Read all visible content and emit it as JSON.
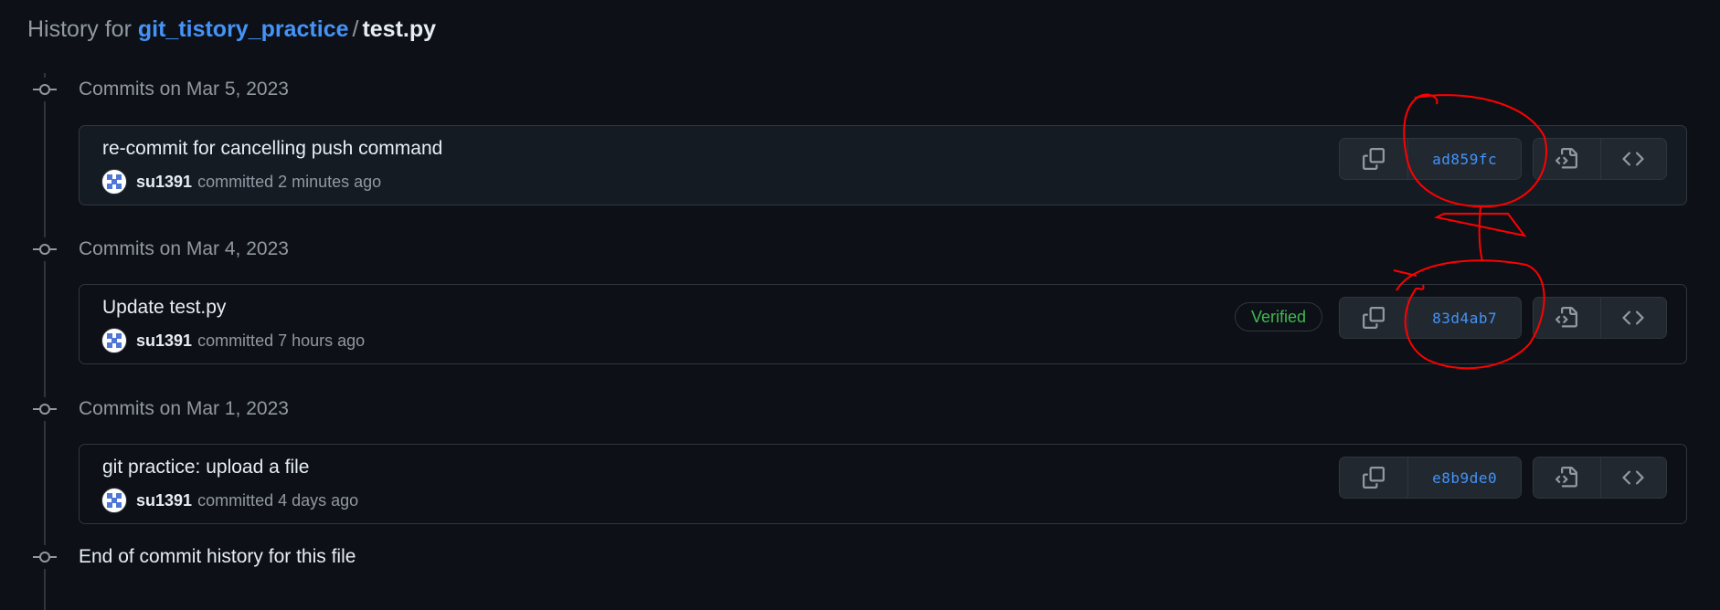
{
  "header": {
    "prefix": "History for",
    "repo": "git_tistory_practice",
    "separator": "/",
    "file": "test.py"
  },
  "groups": [
    {
      "date_label": "Commits on Mar 5, 2023",
      "commit": {
        "message": "re-commit for cancelling push command",
        "author": "su1391",
        "meta": "committed 2 minutes ago",
        "sha": "ad859fc",
        "badge": ""
      }
    },
    {
      "date_label": "Commits on Mar 4, 2023",
      "commit": {
        "message": "Update test.py",
        "author": "su1391",
        "meta": "committed 7 hours ago",
        "sha": "83d4ab7",
        "badge": "Verified"
      }
    },
    {
      "date_label": "Commits on Mar 1, 2023",
      "commit": {
        "message": "git practice: upload a file",
        "author": "su1391",
        "meta": "committed 4 days ago",
        "sha": "e8b9de0",
        "badge": ""
      }
    }
  ],
  "end_label": "End of commit history for this file",
  "icons": {
    "node": "git-commit-icon",
    "copy": "copy-icon",
    "view_file": "file-code-icon",
    "browse": "code-icon",
    "avatar": "identicon-avatar"
  },
  "colors": {
    "background": "#0d1117",
    "link": "#4493f8",
    "verified": "#3fb950",
    "annotation": "#ff0000"
  }
}
